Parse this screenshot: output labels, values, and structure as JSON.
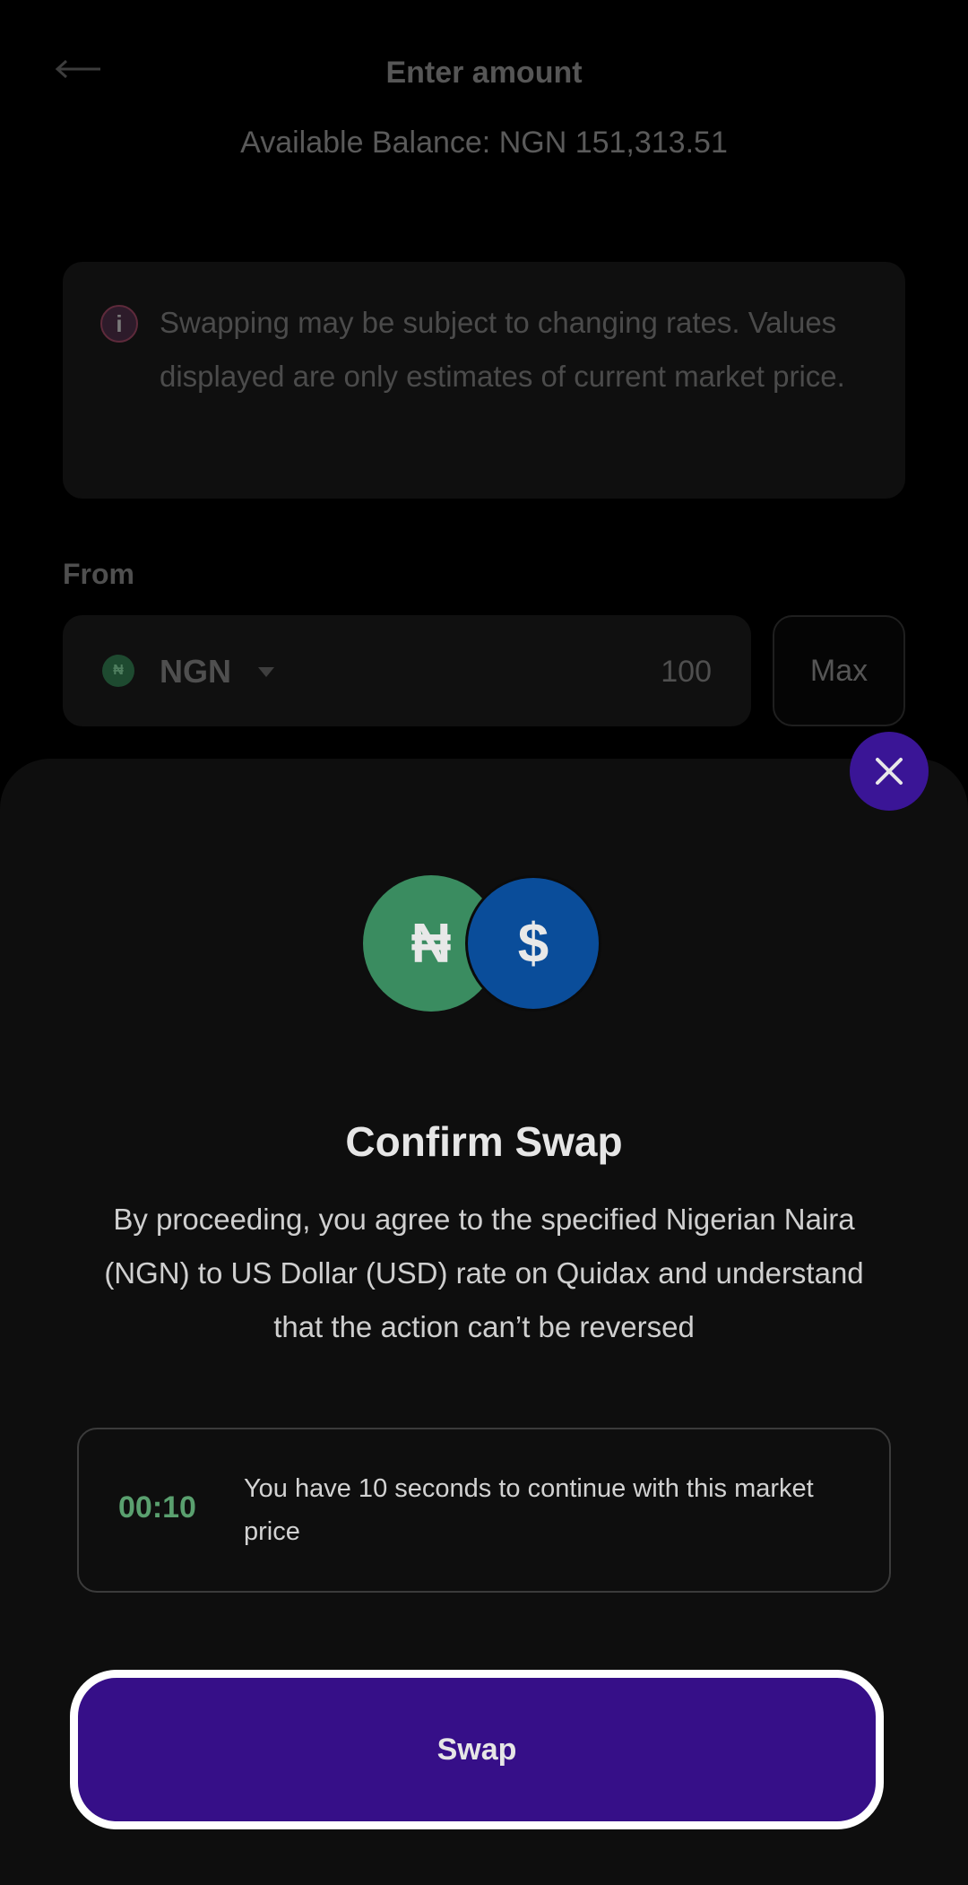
{
  "header": {
    "title": "Enter amount",
    "balance": "Available Balance: NGN 151,313.51"
  },
  "notice": {
    "icon": "info-icon",
    "text": "Swapping may be subject to changing rates. Values displayed are only estimates of current market price."
  },
  "from": {
    "label": "From",
    "currency": "NGN",
    "currency_symbol": "₦",
    "amount": "100",
    "max_label": "Max"
  },
  "confirm_sheet": {
    "coin_from_symbol": "₦",
    "coin_to_symbol": "$",
    "title": "Confirm Swap",
    "description": "By proceeding, you agree to the specified Nigerian Naira (NGN) to US Dollar (USD) rate on Quidax and understand that the action can’t be reversed",
    "timer": "00:10",
    "timer_message": "You have 10 seconds to continue with this market price",
    "swap_label": "Swap"
  },
  "colors": {
    "accent_purple": "#360f88",
    "close_button": "#3a1596",
    "naira_green": "#3a8c60",
    "dollar_blue": "#0a4d9a",
    "timer_green": "#5aa06f"
  }
}
